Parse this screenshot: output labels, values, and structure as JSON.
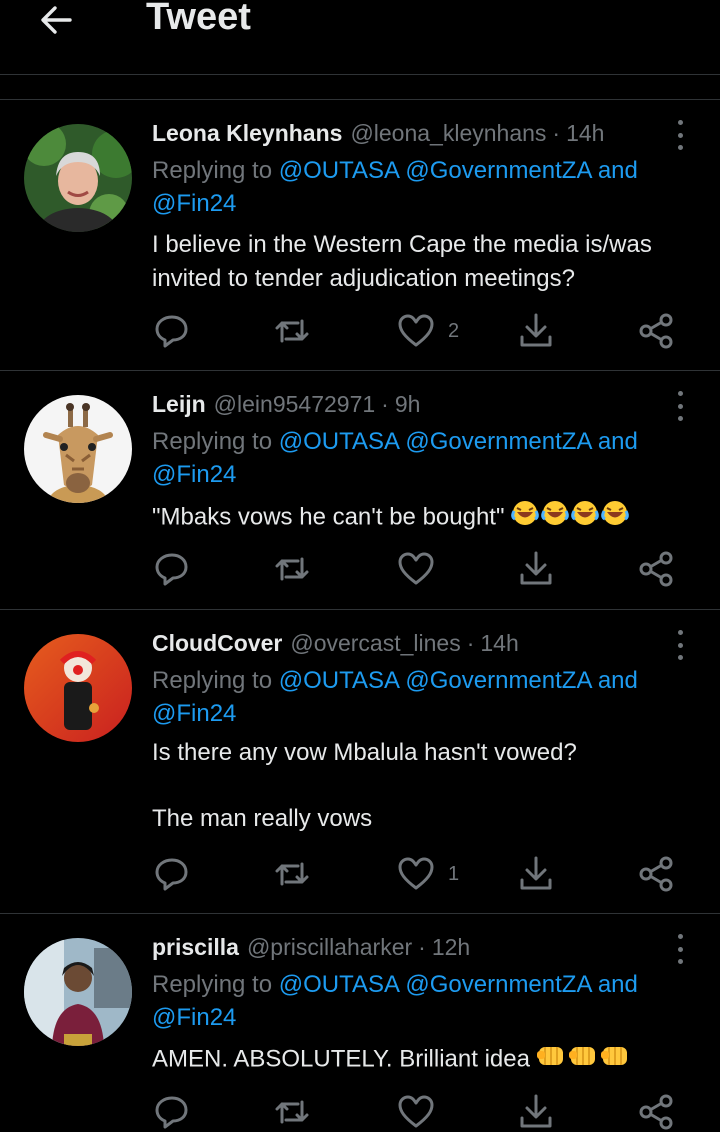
{
  "header": {
    "title": "Tweet",
    "back_icon": "arrow-left-icon"
  },
  "reply_prefix": "Replying to",
  "reply_joiner": "and",
  "colors": {
    "background": "#000000",
    "accent": "#1d9bf0",
    "muted": "#71767b",
    "text": "#e7e9ea",
    "divider": "#2f3336"
  },
  "tweets": [
    {
      "name": "Leona Kleynhans",
      "handle": "@leona_kleynhans",
      "time": "14h",
      "mentions": [
        "@OUTASA",
        "@GovernmentZA",
        "@Fin24"
      ],
      "text": "I believe in the Western Cape the media is/was invited to tender adjudication meetings?",
      "likes": "2",
      "retweets": "",
      "replies": ""
    },
    {
      "name": "Leijn",
      "handle": "@lein95472971",
      "time": "9h",
      "mentions": [
        "@OUTASA",
        "@GovernmentZA",
        "@Fin24"
      ],
      "text": "\"Mbaks vows he can't be bought\"",
      "emoji": "laughing-tears-emoji x4",
      "likes": "",
      "retweets": "",
      "replies": ""
    },
    {
      "name": "CloudCover",
      "handle": "@overcast_lines",
      "time": "14h",
      "mentions": [
        "@OUTASA",
        "@GovernmentZA",
        "@Fin24"
      ],
      "text": "Is there any vow Mbalula hasn't vowed?\n\nThe man really vows",
      "likes": "1",
      "retweets": "",
      "replies": ""
    },
    {
      "name": "priscilla",
      "handle": "@priscillaharker",
      "time": "12h",
      "mentions": [
        "@OUTASA",
        "@GovernmentZA",
        "@Fin24"
      ],
      "text": "AMEN. ABSOLUTELY.  Brilliant idea",
      "emoji": "oncoming-fist-emoji x3",
      "likes": "",
      "retweets": "",
      "replies": ""
    }
  ]
}
